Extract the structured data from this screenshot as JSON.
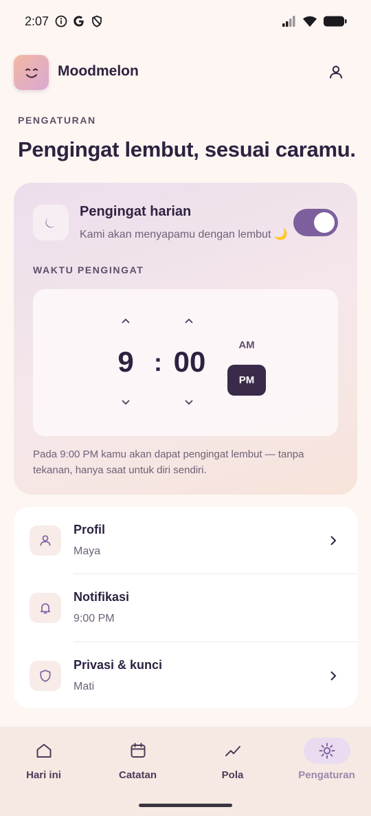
{
  "status_bar": {
    "time": "2:07",
    "left_icons": [
      "info-icon",
      "google-icon",
      "shield-icon"
    ],
    "right_icons": [
      "signal-icon",
      "wifi-icon",
      "battery-icon"
    ]
  },
  "header": {
    "app_name": "Moodmelon",
    "logo_icon": "smile-icon",
    "account_icon": "person-icon"
  },
  "page": {
    "eyebrow": "PENGATURAN",
    "title": "Pengingat lembut, sesuai caramu."
  },
  "reminder": {
    "title": "Pengingat harian",
    "subtitle": "Kami akan menyapamu dengan lembut 🌙",
    "enabled": true,
    "time_label": "WAKTU PENGINGAT",
    "hour": "9",
    "separator": ":",
    "minute": "00",
    "am_label": "AM",
    "pm_label": "PM",
    "selected_period": "PM",
    "note": "Pada 9:00 PM kamu akan dapat pengingat lembut — tanpa tekanan, hanya saat untuk diri sendiri."
  },
  "settings": [
    {
      "title": "Profil",
      "value": "Maya",
      "icon": "person-icon",
      "has_chevron": true
    },
    {
      "title": "Notifikasi",
      "value": "9:00 PM",
      "icon": "bell-icon",
      "has_chevron": false
    },
    {
      "title": "Privasi & kunci",
      "value": "Mati",
      "icon": "shield-icon",
      "has_chevron": true
    }
  ],
  "nav": {
    "items": [
      {
        "label": "Hari ini",
        "icon": "home-icon"
      },
      {
        "label": "Catatan",
        "icon": "calendar-icon"
      },
      {
        "label": "Pola",
        "icon": "trend-icon"
      },
      {
        "label": "Pengaturan",
        "icon": "settings-sun-icon"
      }
    ],
    "active_index": 3
  },
  "colors": {
    "background": "#fdf6f2",
    "accent": "#7d5f9e",
    "dark": "#2e2240",
    "pm_selected": "#3a2b4a",
    "nav_active_bg": "#eadcf0"
  }
}
